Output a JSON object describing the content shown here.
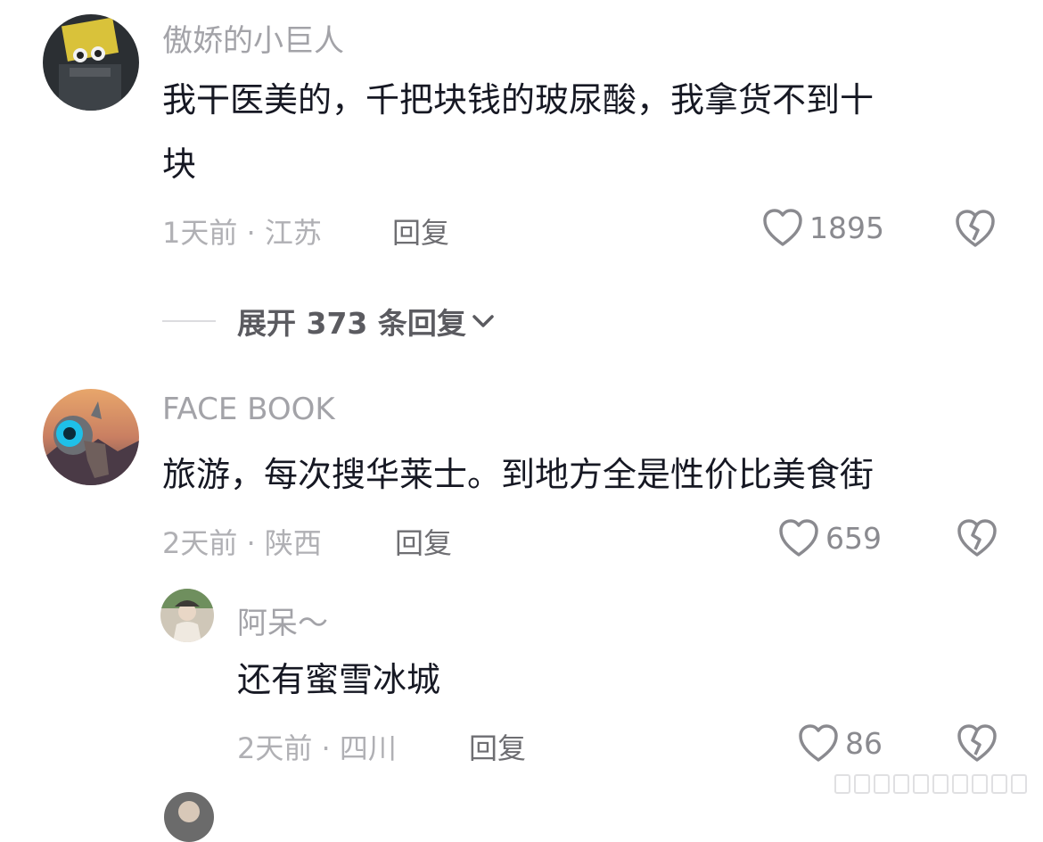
{
  "comments": [
    {
      "username": "傲娇的小巨人",
      "lines": [
        "我干医美的，千把块钱的玻尿酸，我拿货不到十",
        "块"
      ],
      "time": "1天前 · 江苏",
      "reply_label": "回复",
      "likes": "1895",
      "expand_label": "展开 373 条回复"
    },
    {
      "username": "FACE BOOK",
      "lines": [
        "旅游，每次搜华莱士。到地方全是性价比美食街"
      ],
      "time": "2天前 · 陕西",
      "reply_label": "回复",
      "likes": "659"
    },
    {
      "username": "阿呆～",
      "lines": [
        "还有蜜雪冰城"
      ],
      "time": "2天前 · 四川",
      "reply_label": "回复",
      "likes": "86"
    }
  ],
  "icons": {
    "like": "heart-outline-icon",
    "dislike": "broken-heart-icon",
    "expand": "chevron-down-icon"
  },
  "colors": {
    "text": "#161823",
    "muted": "#b0b0b4",
    "reply": "#6e6e72"
  }
}
